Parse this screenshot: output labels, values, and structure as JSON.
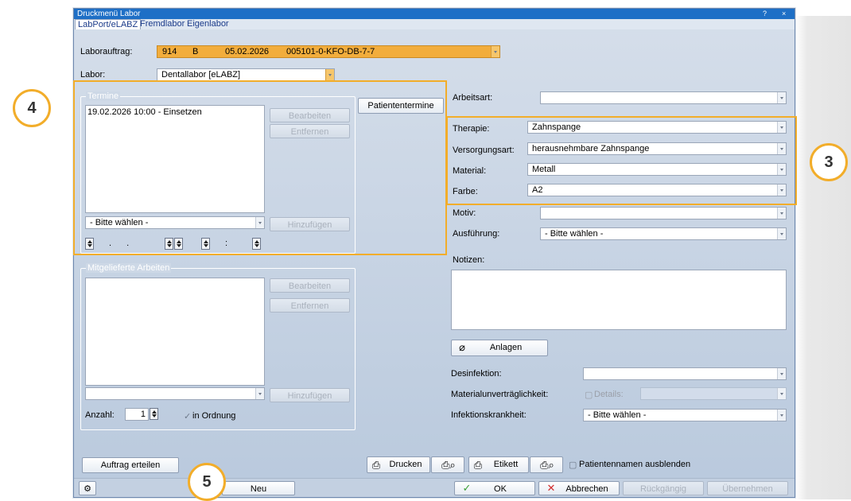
{
  "window": {
    "title": "Druckmenü Labor",
    "help": "?",
    "close": "×"
  },
  "tabs": [
    "LabPort/eLABZ",
    "Fremdlabor",
    "Eigenlabor"
  ],
  "order": {
    "label": "Laborauftrag:",
    "number": "914",
    "code": "B",
    "date": "05.02.2026",
    "ref": "005101-0-KFO-DB-7-7"
  },
  "labor": {
    "label": "Labor:",
    "value": "Dentallabor [eLABZ]"
  },
  "termine": {
    "title": "Termine",
    "items": [
      "19.02.2026 10:00 - Einsetzen"
    ],
    "edit": "Bearbeiten",
    "remove": "Entfernen",
    "select": "- Bitte wählen -",
    "add": "Hinzufügen",
    "date_sep": ". .",
    "time_sep": ":",
    "patient_btn": "Patiententermine"
  },
  "mitgeliefert": {
    "title": "Mitgelieferte Arbeiten",
    "edit": "Bearbeiten",
    "remove": "Entfernen",
    "add": "Hinzufügen",
    "count_label": "Anzahl:",
    "count": "1",
    "ok_label": "in Ordnung"
  },
  "right": {
    "arbeitsart": "Arbeitsart:",
    "therapie_label": "Therapie:",
    "therapie": "Zahnspange",
    "versorgung_label": "Versorgungsart:",
    "versorgung": "herausnehmbare Zahnspange",
    "material_label": "Material:",
    "material": "Metall",
    "farbe_label": "Farbe:",
    "farbe": "A2",
    "motiv_label": "Motiv:",
    "ausfuehrung_label": "Ausführung:",
    "ausfuehrung": "- Bitte wählen -",
    "notizen_label": "Notizen:",
    "anlagen": "Anlagen",
    "desinfektion_label": "Desinfektion:",
    "material_unv_label": "Materialunverträglichkeit:",
    "details": "Details:",
    "infektion_label": "Infektionskrankheit:",
    "infektion": "- Bitte wählen -"
  },
  "bottom": {
    "auftrag": "Auftrag erteilen",
    "drucken": "Drucken",
    "etikett": "Etikett",
    "hide_names": "Patientennamen ausblenden",
    "neu": "Neu",
    "ok": "OK",
    "abbrechen": "Abbrechen",
    "rueck": "Rückgängig",
    "uebernehmen": "Übernehmen"
  },
  "badges": {
    "b3": "3",
    "b4": "4",
    "b5": "5"
  },
  "colors": {
    "accent": "#f2ad2a",
    "title_bar": "#1e6fc6",
    "order_field": "#f2ad3c"
  }
}
